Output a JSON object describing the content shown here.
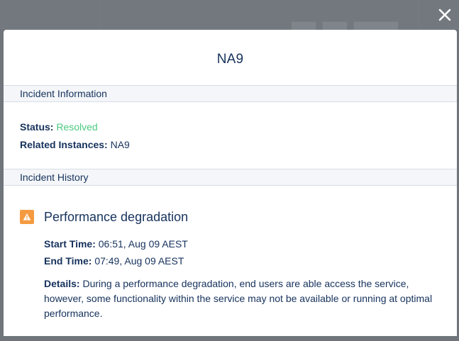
{
  "modal": {
    "title": "NA9",
    "close_icon": "close-icon"
  },
  "incident_information": {
    "header": "Incident Information",
    "status_label": "Status:",
    "status_value": "Resolved",
    "status_color": "#4bca81",
    "instances_label": "Related Instances:",
    "instances_value": "NA9"
  },
  "incident_history": {
    "header": "Incident History",
    "incidents": [
      {
        "icon": "warning-icon",
        "icon_color": "#f49b41",
        "title": "Performance degradation",
        "start_label": "Start Time:",
        "start_value": "06:51, Aug 09 AEST",
        "end_label": "End Time:",
        "end_value": "07:49, Aug 09 AEST",
        "details_label": "Details:",
        "details_value": "During a performance degradation, end users are able access the service, however, some functionality within the service may not be available or running at optimal performance."
      }
    ]
  }
}
